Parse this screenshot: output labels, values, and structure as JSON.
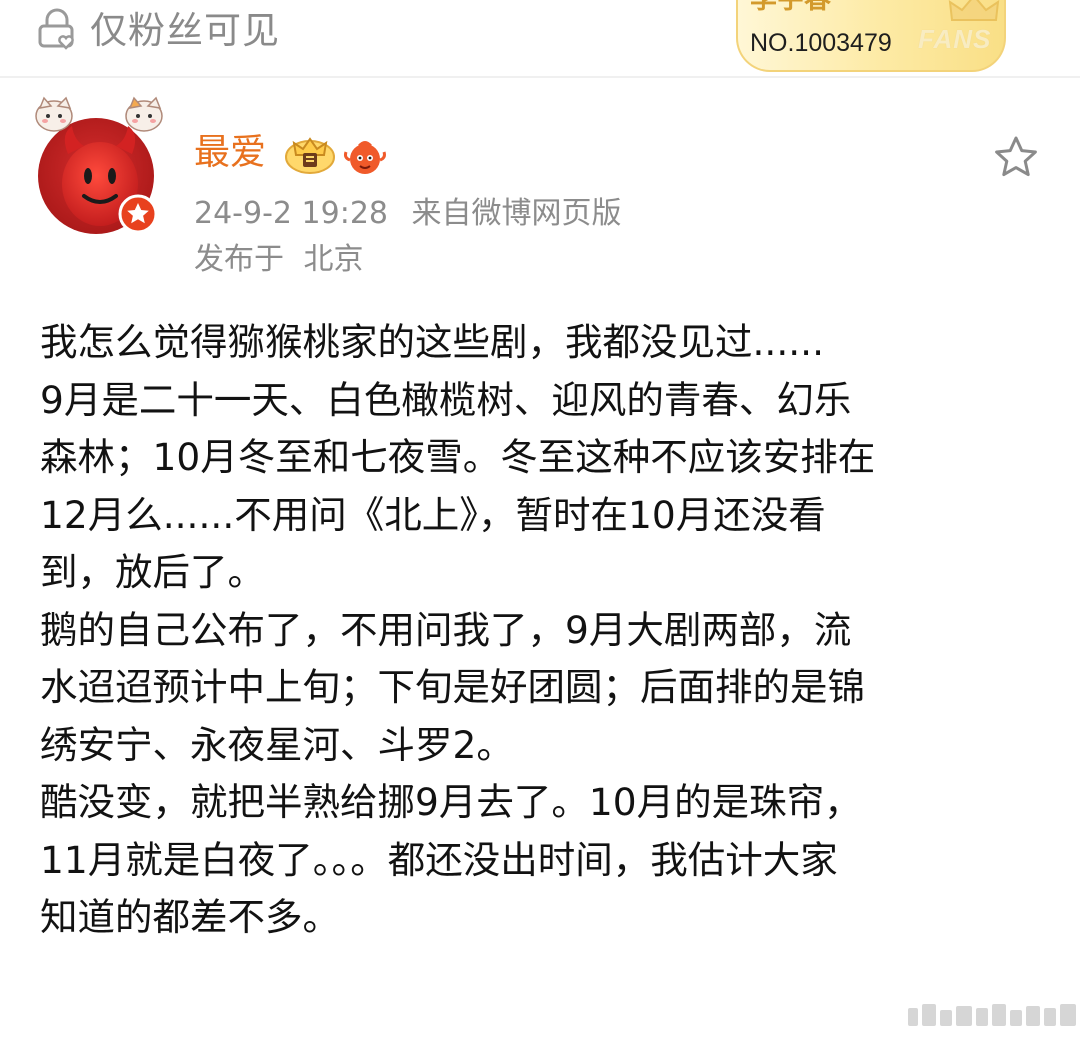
{
  "visibility": {
    "icon": "lock-with-heart-icon",
    "label": "仅粉丝可见"
  },
  "fans_badge": {
    "name": "李宇春",
    "number": "NO.1003479",
    "word": "FANS",
    "icon": "crown-icon"
  },
  "post": {
    "author": {
      "name": "最爱",
      "avatar": "red-smiley-devil-avatar",
      "avatar_badge": "red-star-verified-badge",
      "badges": [
        "gold-crown-membership-badge",
        "red-mascot-badge"
      ]
    },
    "timestamp": "24-9-2 19:28",
    "source": "来自微博网页版",
    "location_prefix": "发布于",
    "location": "北京",
    "favorite_icon": "star-outline-icon",
    "body_lines": [
      "我怎么觉得猕猴桃家的这些剧，我都没见过......",
      "9月是二十一天、白色橄榄树、迎风的青春、幻乐",
      "森林；10月冬至和七夜雪。冬至这种不应该安排在",
      "12月么......不用问《北上》，暂时在10月还没看",
      "到，放后了。",
      "鹅的自己公布了，不用问我了，9月大剧两部，流",
      "水迢迢预计中上旬；下旬是好团圆；后面排的是锦",
      "绣安宁、永夜星河、斗罗2。",
      "酷没变，就把半熟给挪9月去了。10月的是珠帘，",
      "11月就是白夜了。。。都还没出时间，我估计大家",
      "知道的都差不多。"
    ]
  },
  "colors": {
    "username": "#e8711e",
    "meta_text": "#8c8c8c",
    "body_text": "#121212",
    "badge_gold": "#f9df86"
  }
}
